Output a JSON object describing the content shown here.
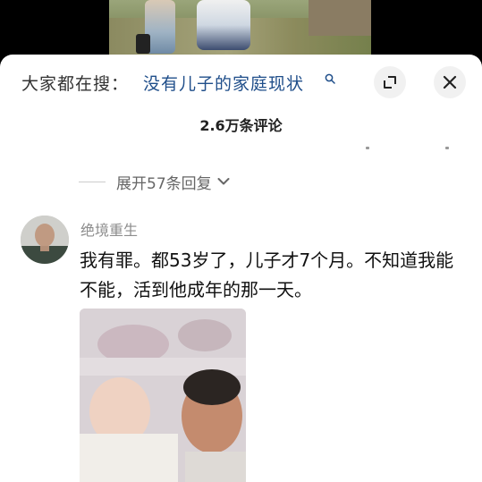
{
  "search": {
    "prefix": "大家都在搜：",
    "term": "没有儿子的家庭现状"
  },
  "comments": {
    "count_label": "2.6万条评论",
    "expand_replies_label": "展开57条回复"
  },
  "comment": {
    "username": "绝境重生",
    "text": "我有罪。都53岁了，儿子才7个月。不知道我能不能，活到他成年的那一天。"
  },
  "icons": {
    "search": "search-icon",
    "expand": "expand-icon",
    "close": "close-icon",
    "chevron": "chevron-down-icon"
  },
  "colors": {
    "search_term": "#1f4e8a",
    "username": "#8c8c8c",
    "button_bg": "#f1f1f1"
  }
}
